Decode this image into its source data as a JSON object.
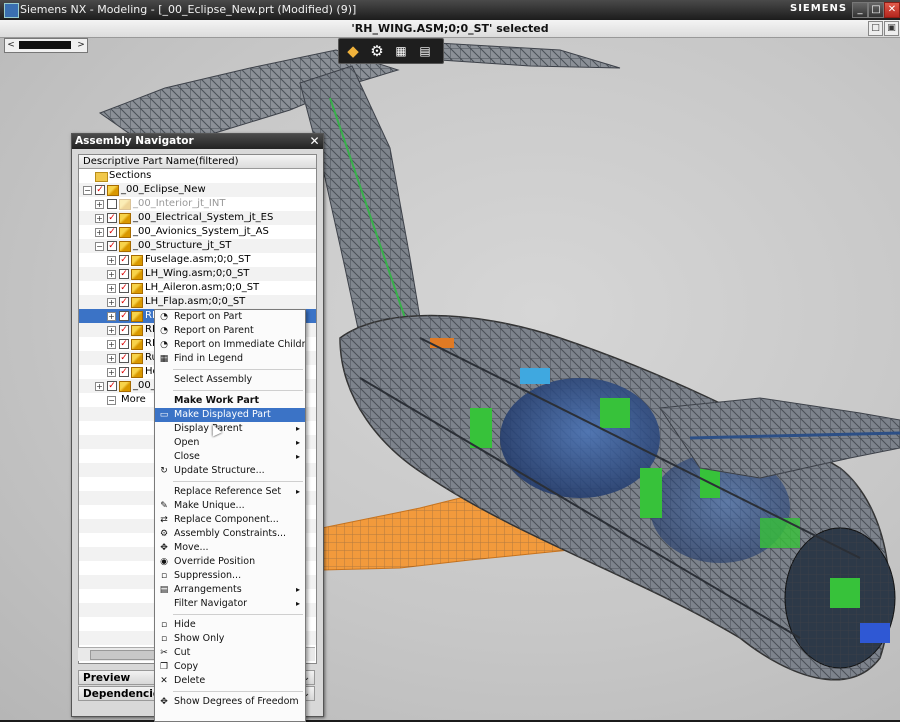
{
  "window": {
    "title": "Siemens NX - Modeling - [_00_Eclipse_New.prt (Modified)  (9)]",
    "brand": "SIEMENS",
    "controls": [
      "_",
      "□",
      "✕"
    ]
  },
  "selection_bar": {
    "message": "'RH_WING.ASM;0;0_ST' selected",
    "controls": [
      "□",
      "▣"
    ]
  },
  "viewport_nav": {
    "left_arrow": "<",
    "right_arrow": ">"
  },
  "view_toolbar": {
    "icons": [
      "render-style-icon",
      "gear-icon",
      "grid-icon",
      "layer-dropdown-icon"
    ]
  },
  "assembly_navigator": {
    "title": "Assembly Navigator",
    "close": "✕",
    "column_header": "Descriptive Part Name(filtered)",
    "rows": [
      {
        "label": "Sections",
        "level": 0,
        "expander": "",
        "checked": null,
        "icon": "folder",
        "grey": false
      },
      {
        "label": "_00_Eclipse_New",
        "level": 0,
        "expander": "−",
        "checked": true,
        "icon": "part",
        "grey": false
      },
      {
        "label": "_00_Interior_jt_INT",
        "level": 1,
        "expander": "+",
        "checked": false,
        "icon": "part",
        "grey": true
      },
      {
        "label": "_00_Electrical_System_jt_ES",
        "level": 1,
        "expander": "+",
        "checked": true,
        "icon": "part",
        "grey": false
      },
      {
        "label": "_00_Avionics_System_jt_AS",
        "level": 1,
        "expander": "+",
        "checked": true,
        "icon": "part",
        "grey": false
      },
      {
        "label": "_00_Structure_jt_ST",
        "level": 1,
        "expander": "−",
        "checked": true,
        "icon": "part",
        "grey": false
      },
      {
        "label": "Fuselage.asm;0;0_ST",
        "level": 2,
        "expander": "+",
        "checked": true,
        "icon": "part",
        "grey": false
      },
      {
        "label": "LH_Wing.asm;0;0_ST",
        "level": 2,
        "expander": "+",
        "checked": true,
        "icon": "part",
        "grey": false
      },
      {
        "label": "LH_Aileron.asm;0;0_ST",
        "level": 2,
        "expander": "+",
        "checked": true,
        "icon": "part",
        "grey": false
      },
      {
        "label": "LH_Flap.asm;0;0_ST",
        "level": 2,
        "expander": "+",
        "checked": true,
        "icon": "part",
        "grey": false
      },
      {
        "label": "RH",
        "level": 2,
        "expander": "+",
        "checked": true,
        "icon": "part",
        "grey": false,
        "selected": true
      },
      {
        "label": "RH",
        "level": 2,
        "expander": "+",
        "checked": true,
        "icon": "part",
        "grey": false
      },
      {
        "label": "RH",
        "level": 2,
        "expander": "+",
        "checked": true,
        "icon": "part",
        "grey": false
      },
      {
        "label": "Ru",
        "level": 2,
        "expander": "+",
        "checked": true,
        "icon": "part",
        "grey": false
      },
      {
        "label": "Ho",
        "level": 2,
        "expander": "+",
        "checked": true,
        "icon": "part",
        "grey": false
      },
      {
        "label": "_00_C",
        "level": 1,
        "expander": "+",
        "checked": true,
        "icon": "part",
        "grey": false
      },
      {
        "label": "More",
        "level": 1,
        "expander": "",
        "checked": null,
        "icon": "more",
        "grey": false
      }
    ],
    "footers": [
      {
        "label": "Preview",
        "chevron": "⌄"
      },
      {
        "label": "Dependencies",
        "chevron": "⌄"
      }
    ]
  },
  "context_menu": {
    "items": [
      {
        "label": "Report on Part",
        "icon": "◔",
        "submenu": false
      },
      {
        "label": "Report on Parent",
        "icon": "◔",
        "submenu": false
      },
      {
        "label": "Report on Immediate Children",
        "icon": "◔",
        "submenu": false
      },
      {
        "label": "Find in Legend",
        "icon": "▦",
        "submenu": false
      },
      {
        "sep": true
      },
      {
        "label": "Select Assembly",
        "icon": "",
        "submenu": false
      },
      {
        "sep": true
      },
      {
        "label": "Make Work Part",
        "icon": "",
        "submenu": false,
        "bold": true
      },
      {
        "label": "Make Displayed Part",
        "icon": "▭",
        "submenu": false,
        "highlighted": true
      },
      {
        "label": "Display Parent",
        "icon": "",
        "submenu": true
      },
      {
        "label": "Open",
        "icon": "",
        "submenu": true
      },
      {
        "label": "Close",
        "icon": "",
        "submenu": true
      },
      {
        "label": "Update Structure...",
        "icon": "↻",
        "submenu": false
      },
      {
        "sep": true
      },
      {
        "label": "Replace Reference Set",
        "icon": "",
        "submenu": true
      },
      {
        "label": "Make Unique...",
        "icon": "✎",
        "submenu": false
      },
      {
        "label": "Replace Component...",
        "icon": "⇄",
        "submenu": false
      },
      {
        "label": "Assembly Constraints...",
        "icon": "⚙",
        "submenu": false
      },
      {
        "label": "Move...",
        "icon": "✥",
        "submenu": false
      },
      {
        "label": "Override Position",
        "icon": "◉",
        "submenu": false
      },
      {
        "label": "Suppression...",
        "icon": "▫",
        "submenu": false
      },
      {
        "label": "Arrangements",
        "icon": "▤",
        "submenu": true
      },
      {
        "label": "Filter Navigator",
        "icon": "",
        "submenu": true
      },
      {
        "sep": true
      },
      {
        "label": "Hide",
        "icon": "▫",
        "submenu": false
      },
      {
        "label": "Show Only",
        "icon": "▫",
        "submenu": false
      },
      {
        "label": "Cut",
        "icon": "✂",
        "submenu": false
      },
      {
        "label": "Copy",
        "icon": "❐",
        "submenu": false
      },
      {
        "label": "Delete",
        "icon": "✕",
        "submenu": false
      },
      {
        "sep": true
      },
      {
        "label": "Show Degrees of Freedom",
        "icon": "✥",
        "submenu": false
      }
    ],
    "submenu_arrow": "▸"
  },
  "colors": {
    "selection": "#3b73c6",
    "wing_orange": "#f29a3c",
    "frame_grey": "#6c737c",
    "fuselage_blue": "#2c4f86",
    "component_green": "#37c23a"
  }
}
